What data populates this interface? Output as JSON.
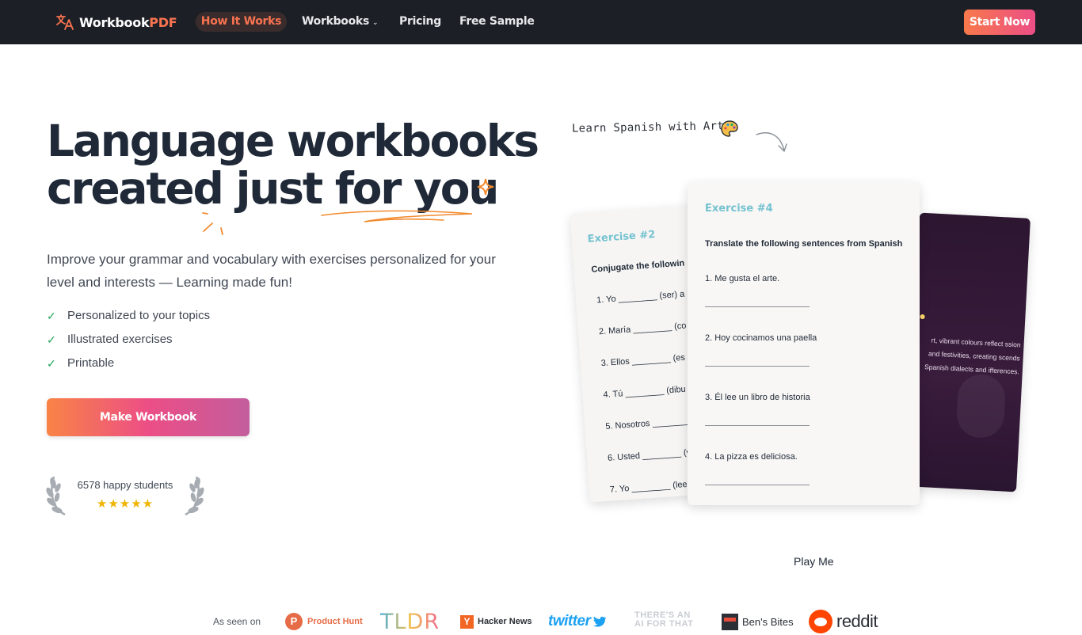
{
  "nav": {
    "logo_main": "Workbook",
    "logo_accent": "PDF",
    "links": [
      "How It Works",
      "Workbooks",
      "Pricing",
      "Free Sample"
    ],
    "cta": "Start Now"
  },
  "hero": {
    "headline_line1": "Language workbooks",
    "headline_line2_a": "created",
    "headline_line2_b": "just",
    "headline_line2_c": "for you",
    "subtitle": "Improve your grammar and vocabulary with exercises personalized for your level and interests — Learning made fun!",
    "features": [
      "Personalized to your topics",
      "Illustrated exercises",
      "Printable"
    ],
    "cta": "Make Workbook",
    "social_proof": "6578 happy students",
    "rating_stars": "★★★★★"
  },
  "showcase": {
    "note": "Learn Spanish with Art",
    "back_card": {
      "title": "Exercise #2",
      "instruction": "Conjugate the followin",
      "items": [
        "1.  Yo ________ (ser) a",
        "2.  María ________ (co",
        "3.  Ellos ________ (es",
        "4.  Tú ________ (dibu",
        "5.  Nosotros ________",
        "6.  Usted ________ (v",
        "7.  Yo ________ (lee"
      ]
    },
    "front_card": {
      "title": "Exercise #4",
      "instruction": "Translate the following sentences from Spanish",
      "items": [
        "1.   Me gusta el arte.",
        "2.   Hoy cocinamos una paella",
        "3.   Él lee un libro de historia",
        "4.   La pizza es deliciosa."
      ]
    },
    "dark_card": {
      "text": "rt, vibrant colours reflect ssion and festivities, creating scends Spanish dialects and ifferences."
    },
    "play": "Play Me"
  },
  "press": {
    "label": "As seen on",
    "product_hunt": "Product Hunt",
    "tldr": "TLDR",
    "hacker_news": "Hacker News",
    "twitter": "twitter",
    "theres_an_ai_1": "THERE'S AN",
    "theres_an_ai_2": "AI FOR THAT",
    "bens_bites": "Ben's Bites",
    "reddit": "reddit"
  },
  "colors": {
    "nav_bg": "#1c2026",
    "accent": "#f97350",
    "cta_gradient_start": "#f98445",
    "cta_gradient_end": "#c35d9d",
    "exercise_title": "#74c2d0"
  }
}
